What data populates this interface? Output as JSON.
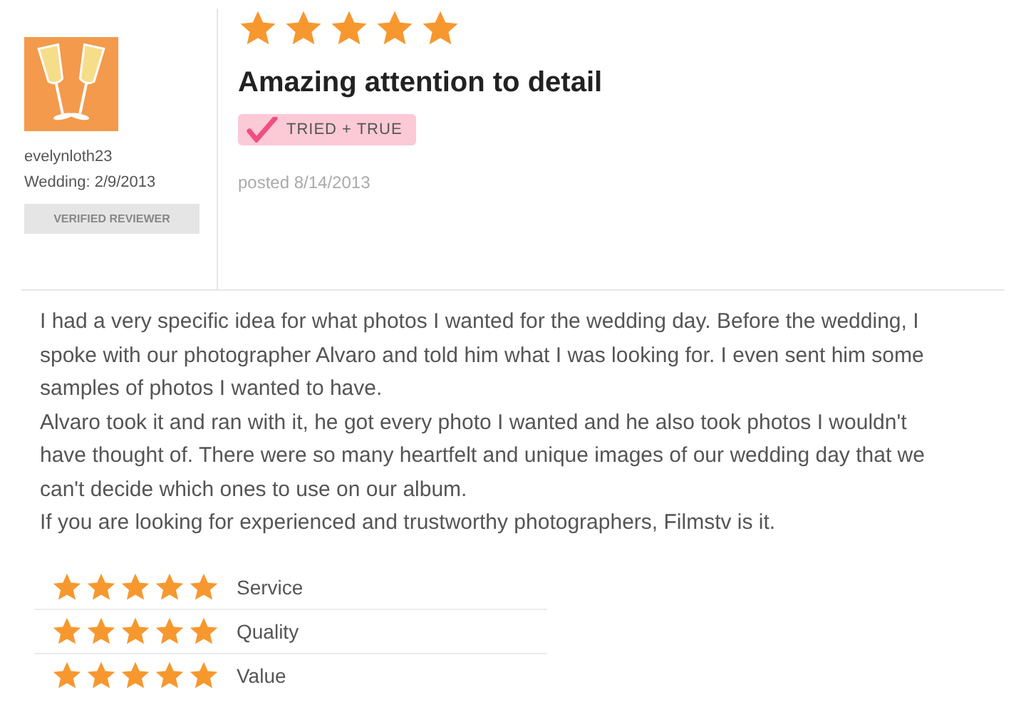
{
  "reviewer": {
    "username": "evelynloth23",
    "wedding": "Wedding: 2/9/2013",
    "badge": "VERIFIED REVIEWER"
  },
  "review": {
    "stars": 5,
    "title": "Amazing attention to detail",
    "tag": "TRIED + TRUE",
    "posted": "posted 8/14/2013",
    "paragraphs": [
      "I had a very specific idea for what photos I wanted for the wedding day. Before the wedding, I spoke with our photographer Alvaro and told him what I was looking for. I even sent him some samples of photos I wanted to have.",
      "Alvaro took it and ran with it, he got every photo I wanted and he also took photos I wouldn't have thought of. There were so many heartfelt and unique images of our wedding day that we can't decide which ones to use on our album.",
      "If you are looking for experienced and trustworthy photographers, Filmstv is it."
    ]
  },
  "ratings": [
    {
      "label": "Service",
      "stars": 5
    },
    {
      "label": "Quality",
      "stars": 5
    },
    {
      "label": "Value",
      "stars": 5
    }
  ]
}
